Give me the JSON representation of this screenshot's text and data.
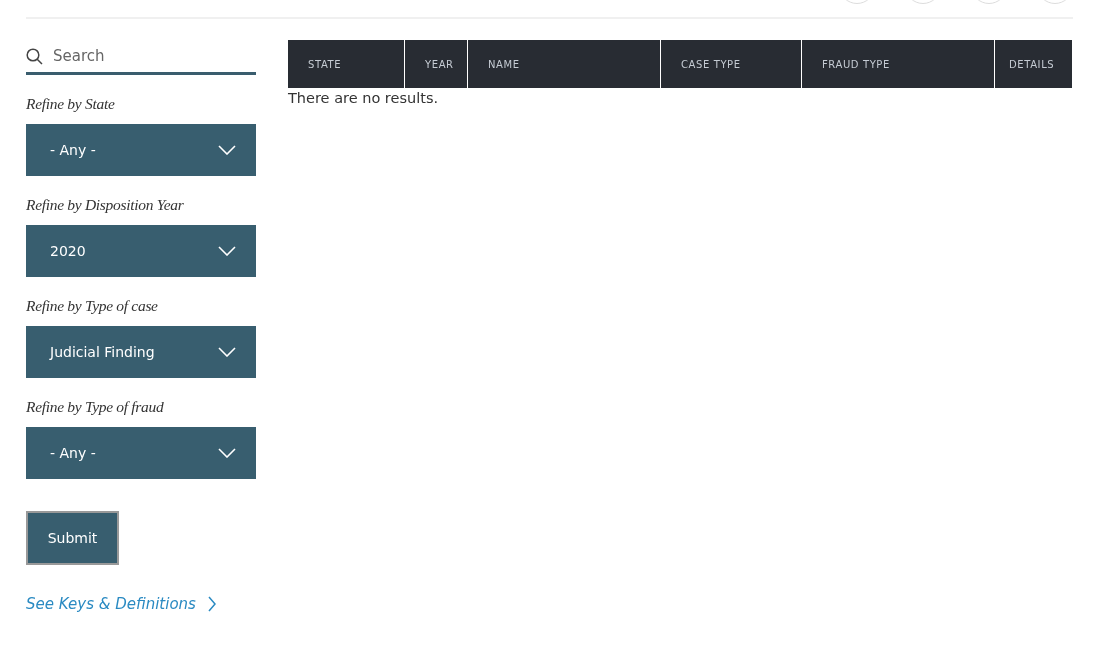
{
  "search": {
    "placeholder": "Search"
  },
  "filters": [
    {
      "label": "Refine by State",
      "value": "- Any -"
    },
    {
      "label": "Refine by Disposition Year",
      "value": "2020"
    },
    {
      "label": "Refine by Type of case",
      "value": "Judicial Finding"
    },
    {
      "label": "Refine by Type of fraud",
      "value": "- Any -"
    }
  ],
  "submit": "Submit",
  "link": "See Keys & Definitions",
  "table": {
    "columns": [
      "STATE",
      "YEAR",
      "NAME",
      "CASE TYPE",
      "FRAUD TYPE",
      "DETAILS"
    ],
    "empty_message": "There are no results."
  }
}
